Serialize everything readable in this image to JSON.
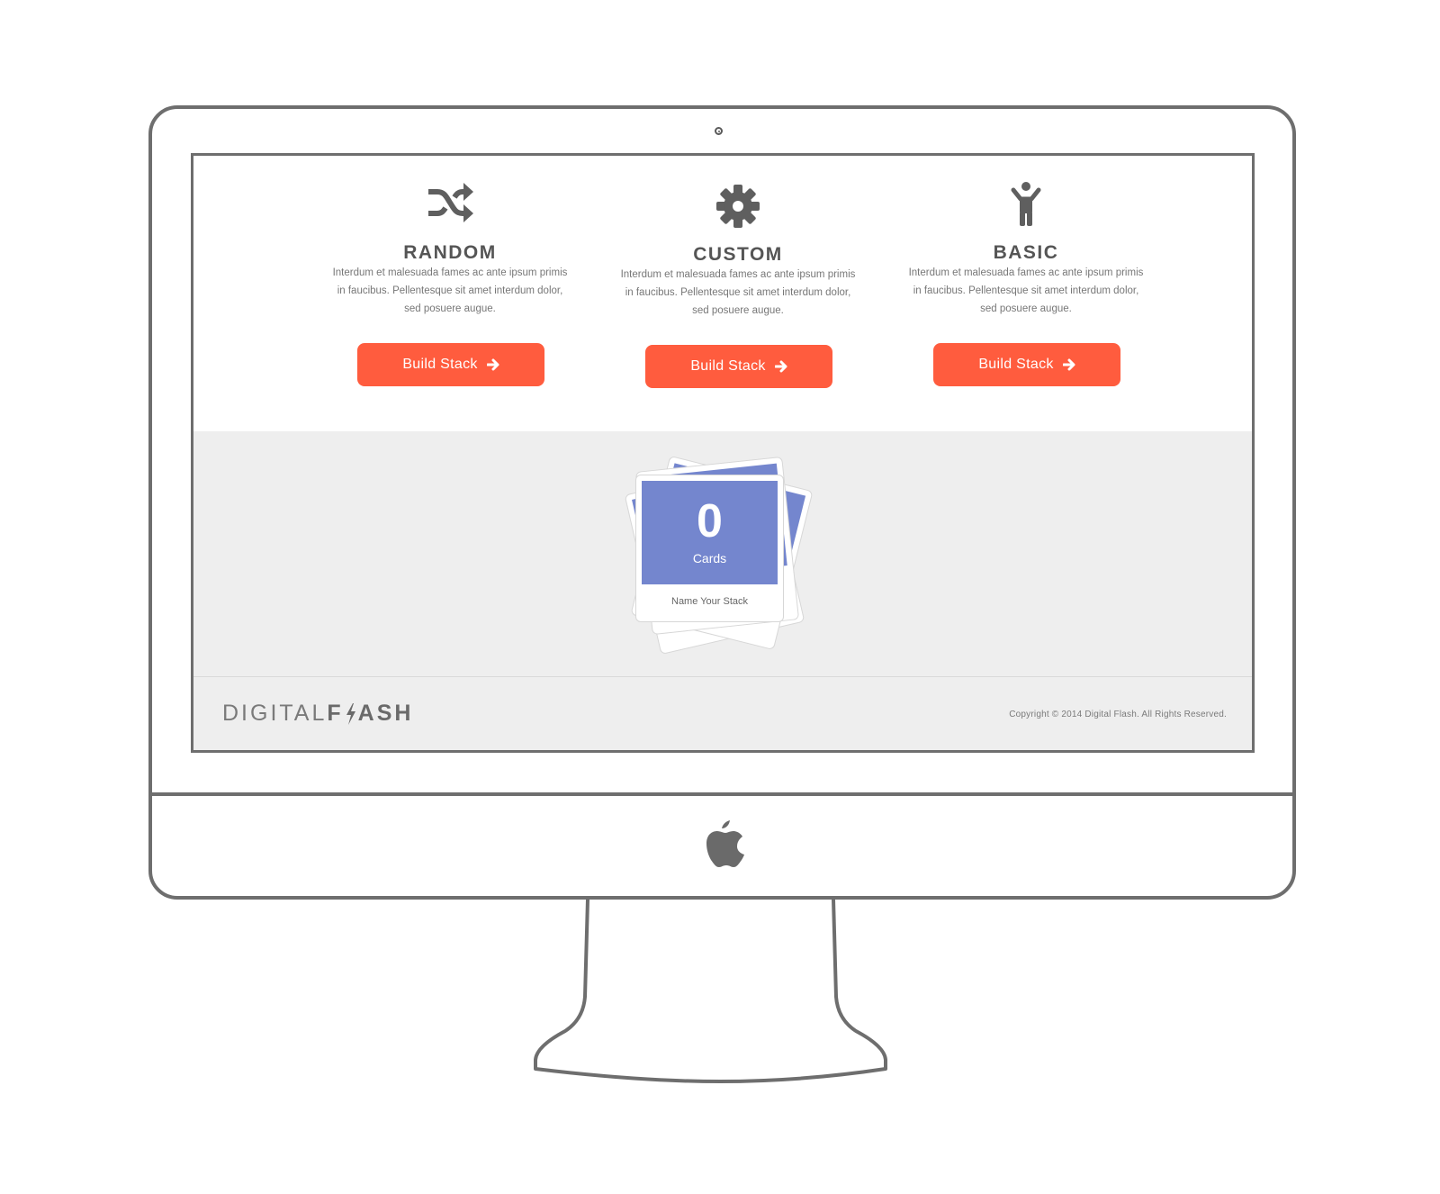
{
  "options": [
    {
      "title": "RANDOM",
      "icon": "shuffle-icon",
      "description_lines": [
        "Interdum et malesuada fames ac ante ipsum primis",
        "in faucibus. Pellentesque sit amet interdum dolor,",
        "sed posuere augue."
      ],
      "button_label": "Build Stack"
    },
    {
      "title": "CUSTOM",
      "icon": "gear-icon",
      "description_lines": [
        "Interdum et malesuada fames ac ante ipsum primis",
        "in faucibus. Pellentesque sit amet interdum dolor,",
        "sed posuere augue."
      ],
      "button_label": "Build Stack"
    },
    {
      "title": "BASIC",
      "icon": "person-icon",
      "description_lines": [
        "Interdum et malesuada fames ac ante ipsum primis",
        "in faucibus. Pellentesque sit amet interdum dolor,",
        "sed posuere augue."
      ],
      "button_label": "Build Stack"
    }
  ],
  "stack": {
    "count": "0",
    "count_label": "Cards",
    "name_placeholder": "Name Your Stack"
  },
  "footer": {
    "brand_light": "DIGITAL",
    "brand_bold_before": "F",
    "brand_bold_after": "ASH",
    "copyright": "Copyright ©  2014 Digital Flash.  All Rights Reserved."
  },
  "colors": {
    "accent": "#ff5c3e",
    "card_blue": "#7486ce",
    "frame": "#6e6e6e",
    "panel_gray": "#eeeeee"
  }
}
